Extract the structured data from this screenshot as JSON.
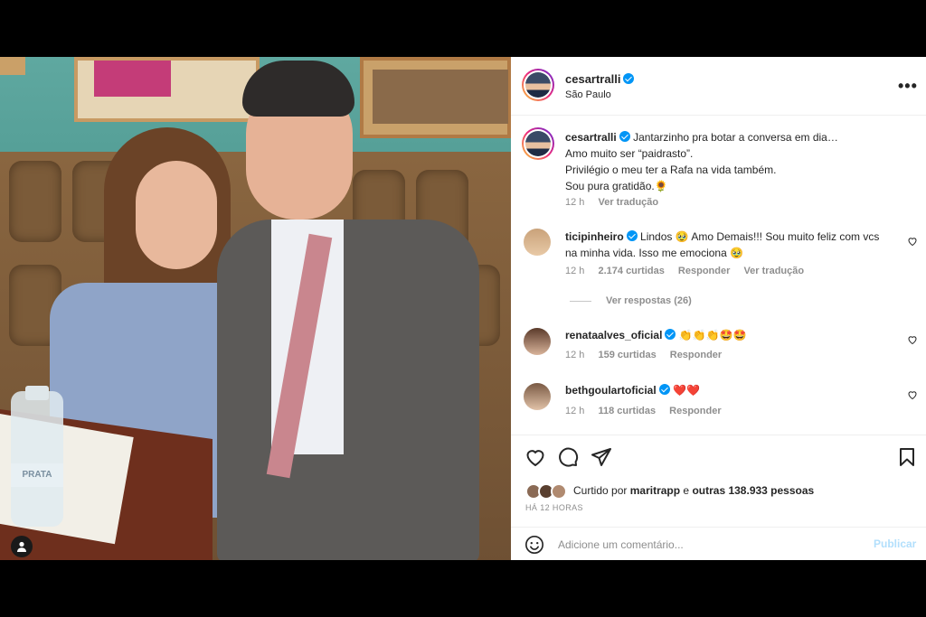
{
  "post": {
    "username": "cesartralli",
    "location": "São Paulo",
    "more_label": "•••"
  },
  "caption": {
    "username": "cesartralli",
    "lines": [
      "Jantarzinho pra botar a conversa em dia…",
      "Amo muito ser “paidrasto”.",
      "Privilégio o meu ter a Rafa na vida também.",
      "Sou pura gratidão.🌻"
    ],
    "time": "12 h",
    "translate": "Ver tradução"
  },
  "comments": [
    {
      "username": "ticipinheiro",
      "text_line1": "Lindos 🥹 Amo Demais!!! Sou muito feliz com vcs",
      "text_line2": "na minha vida. Isso me emociona 🥹",
      "time": "12 h",
      "likes": "2.174 curtidas",
      "reply": "Responder",
      "translate": "Ver tradução",
      "view_replies": "Ver respostas (26)"
    },
    {
      "username": "renataalves_oficial",
      "text": "👏👏👏🤩🤩",
      "time": "12 h",
      "likes": "159 curtidas",
      "reply": "Responder"
    },
    {
      "username": "bethgoulartoficial",
      "text": "❤️❤️",
      "time": "12 h",
      "likes": "118 curtidas",
      "reply": "Responder"
    }
  ],
  "likes": {
    "prefix": "Curtido por",
    "user": "maritrapp",
    "middle": "e",
    "others": "outras 138.933 pessoas"
  },
  "timestamp": "HÁ 12 HORAS",
  "add_comment": {
    "placeholder": "Adicione um comentário...",
    "publish": "Publicar"
  },
  "photo": {
    "bottle_label": "PRATA"
  },
  "colors": {
    "verified": "#0095f6",
    "publish_disabled": "#b2dffc",
    "heart_red": "#ed4956"
  }
}
